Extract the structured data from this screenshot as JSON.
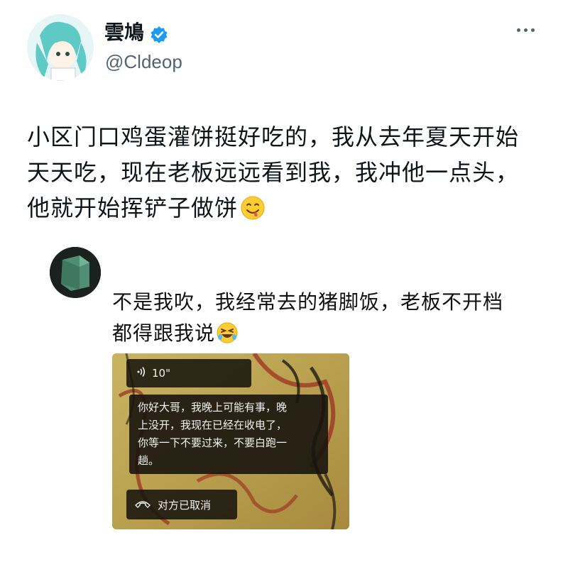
{
  "author": {
    "display_name": "雲鳩",
    "handle": "@Cldeop",
    "verified_icon": "verified-badge-icon",
    "verified_color": "#1d9bf0"
  },
  "tweet": {
    "text": "小区门口鸡蛋灌饼挺好吃的，我从去年夏天开始天天吃，现在老板远远看到我，我冲他一点头，他就开始挥铲子做饼",
    "emoji": "yum-face-emoji"
  },
  "reply": {
    "text": "不是我吹，我经常去的猪脚饭，老板不开档都得跟我说",
    "emoji": "rolling-laughing-emoji"
  },
  "screenshot": {
    "voice_duration": "10\"",
    "message": "你好大哥，我晚上可能有事，晚\n上没开，我现在已经在收电了，\n你等一下不要过来，不要白跑一\n趟。",
    "call_status": "对方已取消"
  }
}
